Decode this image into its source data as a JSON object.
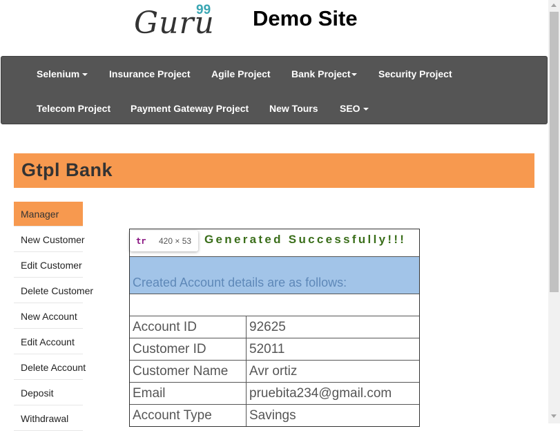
{
  "header": {
    "logo_text": "Guru",
    "logo_sup": "99",
    "site_title": "Demo Site"
  },
  "nav": {
    "row1": [
      {
        "label": "Selenium",
        "caret": true
      },
      {
        "label": "Insurance Project",
        "caret": false
      },
      {
        "label": "Agile Project",
        "caret": false
      },
      {
        "label": "Bank Project",
        "caret": true
      },
      {
        "label": "Security Project",
        "caret": false
      }
    ],
    "row2": [
      {
        "label": "Telecom Project",
        "caret": false
      },
      {
        "label": "Payment Gateway Project",
        "caret": false
      },
      {
        "label": "New Tours",
        "caret": false
      },
      {
        "label": "SEO",
        "caret": true
      }
    ]
  },
  "bank": {
    "title": "Gtpl Bank"
  },
  "sidebar": {
    "items": [
      {
        "label": "Manager",
        "active": true
      },
      {
        "label": "New Customer"
      },
      {
        "label": "Edit Customer"
      },
      {
        "label": "Delete Customer"
      },
      {
        "label": "New Account"
      },
      {
        "label": "Edit Account"
      },
      {
        "label": "Delete Account"
      },
      {
        "label": "Deposit"
      },
      {
        "label": "Withdrawal"
      }
    ]
  },
  "result": {
    "message": "Generated Successfully!!!",
    "tooltip_tag": "tr",
    "tooltip_size": "420 × 53",
    "details_heading": "Created Account details are as follows:",
    "rows": [
      {
        "label": "Account ID",
        "value": "92625"
      },
      {
        "label": "Customer ID",
        "value": "52011"
      },
      {
        "label": "Customer Name",
        "value": "Avr ortiz"
      },
      {
        "label": "Email",
        "value": "pruebita234@gmail.com"
      },
      {
        "label": "Account Type",
        "value": "Savings"
      }
    ]
  },
  "colors": {
    "accent": "#f7994f",
    "navbar": "#555555",
    "details_bg": "#a2c4e8",
    "success_text": "#3a6e1a"
  }
}
